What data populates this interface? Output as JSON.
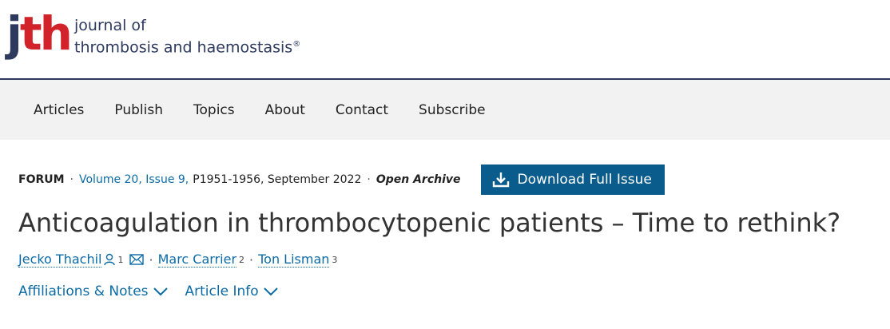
{
  "header": {
    "logo_j": "j",
    "logo_th": "th",
    "journal_line1": "journal of",
    "journal_line2": "thrombosis and haemostasis",
    "registered": "®"
  },
  "nav": {
    "items": [
      "Articles",
      "Publish",
      "Topics",
      "About",
      "Contact",
      "Subscribe"
    ]
  },
  "article": {
    "type": "FORUM",
    "volume_issue": "Volume 20, Issue 9,",
    "pages_date": "P1951-1956, September 2022",
    "access": "Open Archive",
    "download_label": "Download Full Issue",
    "title": "Anticoagulation in thrombocytopenic patients – Time to rethink?",
    "authors": [
      {
        "name": "Jecko Thachil",
        "sup": "1"
      },
      {
        "name": "Marc Carrier",
        "sup": "2"
      },
      {
        "name": "Ton Lisman",
        "sup": "3"
      }
    ],
    "affiliations_label": "Affiliations & Notes",
    "article_info_label": "Article Info"
  },
  "colors": {
    "brand_navy": "#2d3a5e",
    "brand_red": "#d2232a",
    "link_blue": "#0c6ba5",
    "button_blue": "#0a5c8c"
  }
}
